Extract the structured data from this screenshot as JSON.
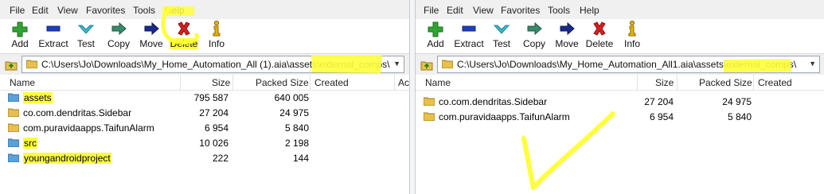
{
  "menu": [
    "File",
    "Edit",
    "View",
    "Favorites",
    "Tools",
    "Help"
  ],
  "toolbar": {
    "add": "Add",
    "extract": "Extract",
    "test": "Test",
    "copy": "Copy",
    "move": "Move",
    "delete": "Delete",
    "info": "Info"
  },
  "columns": {
    "name": "Name",
    "size": "Size",
    "packed": "Packed Size",
    "created": "Created",
    "extra": "Ac"
  },
  "left": {
    "path": "C:\\Users\\Jo\\Downloads\\My_Home_Automation_All (1).aia\\assets\\external_comps\\",
    "rows": [
      {
        "name": "assets",
        "size": "795 587",
        "packed": "640 005"
      },
      {
        "name": "co.com.dendritas.Sidebar",
        "size": "27 204",
        "packed": "24 975"
      },
      {
        "name": "com.puravidaapps.TaifunAlarm",
        "size": "6 954",
        "packed": "5 840"
      },
      {
        "name": "src",
        "size": "10 026",
        "packed": "2 198"
      },
      {
        "name": "youngandroidproject",
        "size": "222",
        "packed": "144"
      }
    ]
  },
  "right": {
    "path": "C:\\Users\\Jo\\Downloads\\My_Home_Automation_All1.aia\\assets\\external_comps\\",
    "rows": [
      {
        "name": "co.com.dendritas.Sidebar",
        "size": "27 204",
        "packed": "24 975"
      },
      {
        "name": "com.puravidaapps.TaifunAlarm",
        "size": "6 954",
        "packed": "5 840"
      }
    ]
  },
  "colors": {
    "highlight": "#ffff3c",
    "add": "#2fa42f",
    "extract": "#1e3fb8",
    "test": "#3fb9c9",
    "copy": "#3a8a6c",
    "move": "#1a2a8a",
    "delete": "#d42020",
    "info": "#e6b400"
  }
}
